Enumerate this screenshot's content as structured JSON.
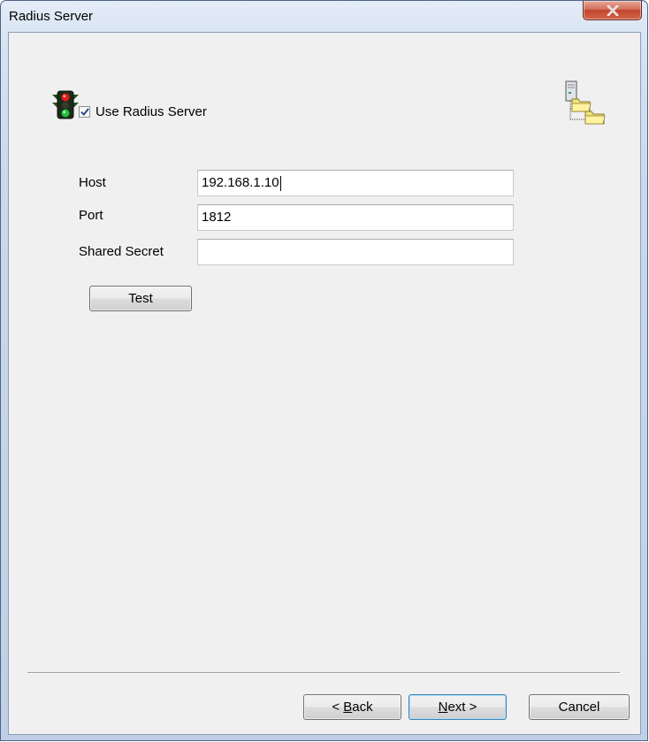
{
  "window": {
    "title": "Radius Server",
    "close_icon": "close-icon"
  },
  "icons": {
    "header_left": "traffic-light-icon",
    "header_right": "server-folder-icon"
  },
  "use_radius": {
    "label": "Use Radius Server",
    "checked": true
  },
  "fields": {
    "host": {
      "label": "Host",
      "value": "192.168.1.10"
    },
    "port": {
      "label": "Port",
      "value": "1812"
    },
    "shared_secret": {
      "label": "Shared Secret",
      "value": ""
    }
  },
  "buttons": {
    "test": "Test",
    "back_mnemonic": "B",
    "back_rest": "ack",
    "back_prefix": "< ",
    "next_mnemonic": "N",
    "next_rest": "ext >",
    "cancel": "Cancel"
  },
  "colors": {
    "dialog_background": "#f0f0f0",
    "close_button": "#c0462f",
    "default_button_border": "#3c7fb1"
  }
}
